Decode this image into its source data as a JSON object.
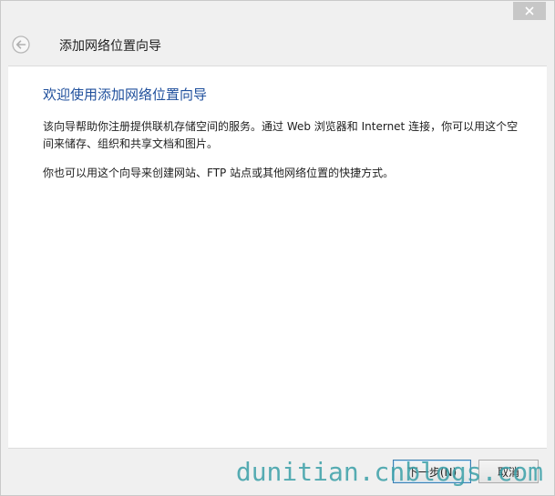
{
  "window": {
    "close_icon": "close-icon"
  },
  "header": {
    "back_icon": "back-arrow-icon",
    "title": "添加网络位置向导"
  },
  "content": {
    "heading": "欢迎使用添加网络位置向导",
    "paragraph1": "该向导帮助你注册提供联机存储空间的服务。通过 Web 浏览器和 Internet 连接，你可以用这个空间来储存、组织和共享文档和图片。",
    "paragraph2": "你也可以用这个向导来创建网站、FTP 站点或其他网络位置的快捷方式。"
  },
  "footer": {
    "next_label": "下一步(N)",
    "cancel_label": "取消"
  },
  "watermark": {
    "text": "dunitian.cnblogs.com"
  },
  "colors": {
    "heading": "#1f4f9c",
    "watermark": "#3aa0a8",
    "close_button_bg": "#c7c7c7"
  }
}
